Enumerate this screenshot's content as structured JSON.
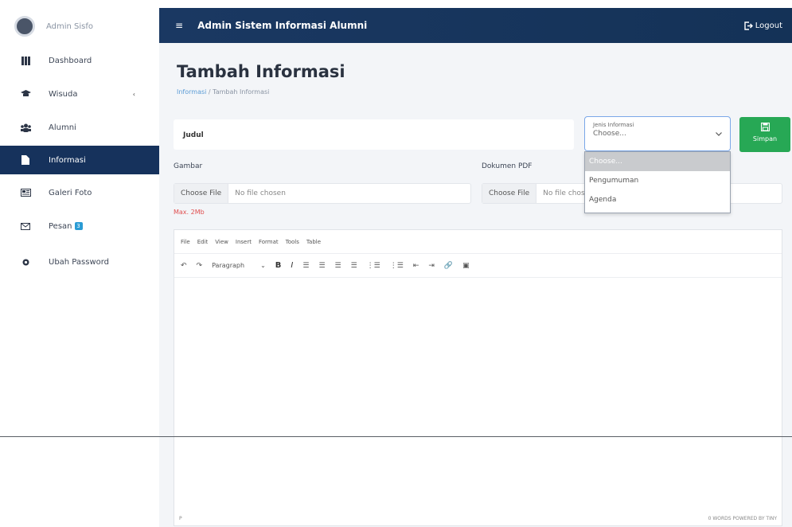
{
  "sidebar": {
    "brand_name": "Admin Sisfo",
    "items": [
      {
        "label": "Dashboard",
        "icon": "grid-icon"
      },
      {
        "label": "Wisuda",
        "icon": "graduation-cap-icon",
        "caret": "‹"
      },
      {
        "label": "Alumni",
        "icon": "users-icon"
      },
      {
        "label": "Informasi",
        "icon": "file-icon"
      },
      {
        "label": "Galeri Foto",
        "icon": "image-icon"
      },
      {
        "label": "Pesan",
        "icon": "envelope-icon",
        "badge": "3"
      },
      {
        "label": "Ubah Password",
        "icon": "gear-icon"
      }
    ]
  },
  "topbar": {
    "menu_glyph": "≡",
    "title": "Admin Sistem Informasi Alumni",
    "logout_label": "Logout"
  },
  "page": {
    "title": "Tambah Informasi",
    "breadcrumb_link": "Informasi",
    "breadcrumb_sep": " / ",
    "breadcrumb_current": "Tambah Informasi"
  },
  "form": {
    "judul_placeholder": "Judul",
    "jenis_label": "Jenis Informasi",
    "jenis_value": "Choose...",
    "jenis_options": [
      "Choose...",
      "Pengumuman",
      "Agenda"
    ],
    "simpan_label": "Simpan",
    "gambar_label": "Gambar",
    "gambar_button": "Choose File",
    "gambar_text": "No file chosen",
    "gambar_note": "Max. 2Mb",
    "pdf_label": "Dokumen PDF",
    "pdf_button": "Choose File",
    "pdf_text": "No file chosen"
  },
  "editor": {
    "menus": [
      "File",
      "Edit",
      "View",
      "Insert",
      "Format",
      "Tools",
      "Table"
    ],
    "paragraph_label": "Paragraph",
    "status_left": "P",
    "status_right": "0 WORDS  POWERED BY TINY"
  },
  "colors": {
    "sidebar_active": "#16325c",
    "topbar": "#1a3862",
    "simpan": "#27a855",
    "note_red": "#e05050"
  }
}
